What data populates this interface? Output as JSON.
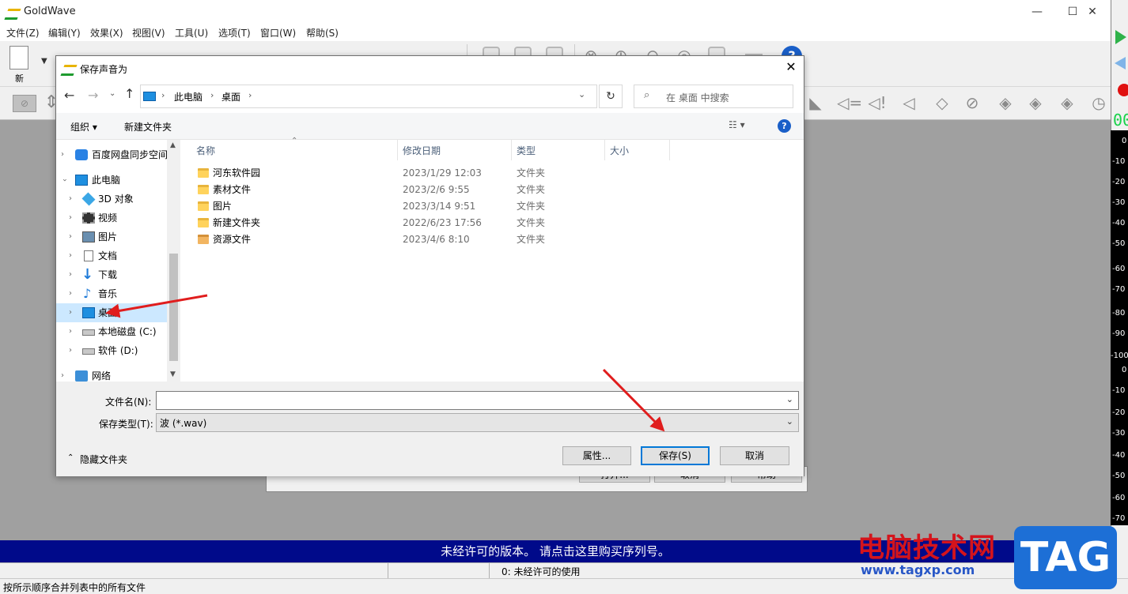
{
  "app": {
    "title": "GoldWave",
    "minimize": "—",
    "maximize": "☐",
    "close": "✕"
  },
  "menu": [
    "文件(Z)",
    "编辑(Y)",
    "效果(X)",
    "视图(V)",
    "工具(U)",
    "选项(T)",
    "窗口(W)",
    "帮助(S)"
  ],
  "toolbar": {
    "new_label": "新"
  },
  "meter": {
    "top": "00",
    "labels": [
      "0",
      "-10",
      "-20",
      "-30",
      "-40",
      "-50",
      "-60",
      "-70",
      "-80",
      "-90",
      "-100",
      "0",
      "-10",
      "-20",
      "-30",
      "-40",
      "-50",
      "-60",
      "-70"
    ]
  },
  "behind_dialog": {
    "open": "打开...",
    "cancel": "取消",
    "help": "帮助"
  },
  "dialog": {
    "title": "保存声音为",
    "breadcrumb": [
      "此电脑",
      "桌面"
    ],
    "search_placeholder": "在 桌面 中搜索",
    "organize": "组织 ▾",
    "new_folder": "新建文件夹",
    "nav": [
      {
        "label": "百度网盘同步空间"
      },
      {
        "label": "此电脑"
      },
      {
        "label": "3D 对象"
      },
      {
        "label": "视频"
      },
      {
        "label": "图片"
      },
      {
        "label": "文档"
      },
      {
        "label": "下载"
      },
      {
        "label": "音乐"
      },
      {
        "label": "桌面"
      },
      {
        "label": "本地磁盘 (C:)"
      },
      {
        "label": "软件 (D:)"
      },
      {
        "label": "网络"
      }
    ],
    "columns": {
      "name": "名称",
      "modified": "修改日期",
      "type": "类型",
      "size": "大小"
    },
    "files": [
      {
        "name": "河东软件园",
        "modified": "2023/1/29 12:03",
        "type": "文件夹"
      },
      {
        "name": "素材文件",
        "modified": "2023/2/6 9:55",
        "type": "文件夹"
      },
      {
        "name": "图片",
        "modified": "2023/3/14 9:51",
        "type": "文件夹"
      },
      {
        "name": "新建文件夹",
        "modified": "2022/6/23 17:56",
        "type": "文件夹"
      },
      {
        "name": "资源文件",
        "modified": "2023/4/6 8:10",
        "type": "文件夹"
      }
    ],
    "filename_label": "文件名(N):",
    "filename_value": "",
    "filetype_label": "保存类型(T):",
    "filetype_value": "波 (*.wav)",
    "hide_folders": "隐藏文件夹",
    "properties": "属性...",
    "save": "保存(S)",
    "cancel": "取消"
  },
  "banner": "未经许可的版本。 请点击这里购买序列号。",
  "status_mid": "0:  未经许可的使用",
  "status_bottom": "按所示顺序合并列表中的所有文件",
  "watermark": {
    "brand": "电脑技术网",
    "url": "www.tagxp.com",
    "tag": "TAG"
  }
}
